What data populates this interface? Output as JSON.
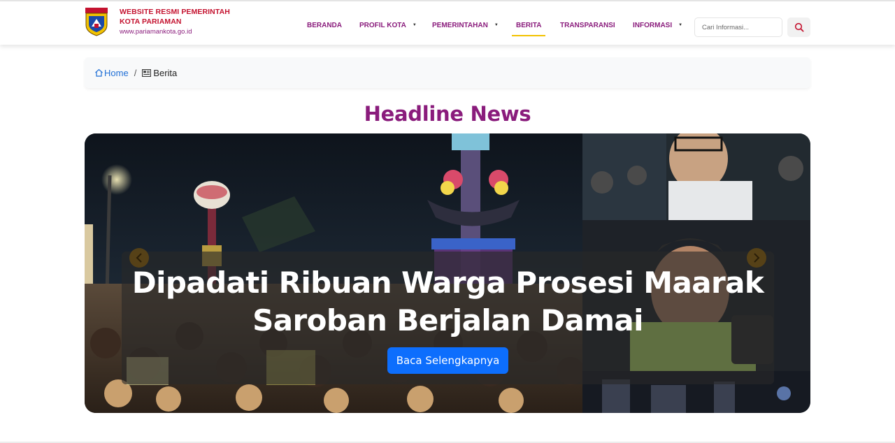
{
  "site": {
    "title_line1": "WEBSITE RESMI PEMERINTAH",
    "title_line2": "KOTA PARIAMAN",
    "url": "www.pariamankota.go.id",
    "logo_icon": "city-crest-logo"
  },
  "nav": {
    "items": [
      {
        "label": "BERANDA",
        "dropdown": false,
        "active": false
      },
      {
        "label": "PROFIL KOTA",
        "dropdown": true,
        "active": false
      },
      {
        "label": "PEMERINTAHAN",
        "dropdown": true,
        "active": false
      },
      {
        "label": "BERITA",
        "dropdown": false,
        "active": true
      },
      {
        "label": "TRANSPARANSI",
        "dropdown": false,
        "active": false
      },
      {
        "label": "INFORMASI",
        "dropdown": true,
        "active": false
      }
    ],
    "search_placeholder": "Cari Informasi...",
    "search_icon": "search-icon"
  },
  "breadcrumb": {
    "home_label": "Home",
    "separator": "/",
    "current_label": "Berita"
  },
  "headline": {
    "title": "Headline News",
    "slide_title_line1": "Dipadati Ribuan Warga Prosesi Maarak",
    "slide_title_line2": "Saroban Berjalan Damai",
    "read_more_label": "Baca Selengkapnya"
  },
  "colors": {
    "brand_purple": "#8a1c7c",
    "brand_red": "#c4122f",
    "active_underline": "#f2c200",
    "button_blue": "#0d6efd"
  }
}
